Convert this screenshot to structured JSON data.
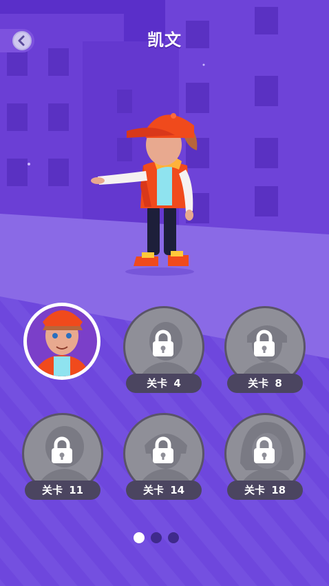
{
  "header": {
    "title": "凯文",
    "back_icon": "chevron-left-icon"
  },
  "character": {
    "name": "凯文",
    "selected": true
  },
  "skins": [
    {
      "id": "kevin",
      "unlocked": true,
      "level_label": "",
      "level_number": ""
    },
    {
      "id": "skin2",
      "unlocked": false,
      "level_label": "关卡",
      "level_number": "4"
    },
    {
      "id": "skin3",
      "unlocked": false,
      "level_label": "关卡",
      "level_number": "8"
    },
    {
      "id": "skin4",
      "unlocked": false,
      "level_label": "关卡",
      "level_number": "11"
    },
    {
      "id": "skin5",
      "unlocked": false,
      "level_label": "关卡",
      "level_number": "14"
    },
    {
      "id": "skin6",
      "unlocked": false,
      "level_label": "关卡",
      "level_number": "18"
    }
  ],
  "pagination": {
    "total_pages": 3,
    "current_page": 1
  },
  "colors": {
    "background": "#6a3fd6",
    "locked_disc": "#8f8f98",
    "badge": "#4b4560",
    "dot_active": "#ffffff",
    "dot_inactive": "#3f2a8c"
  }
}
